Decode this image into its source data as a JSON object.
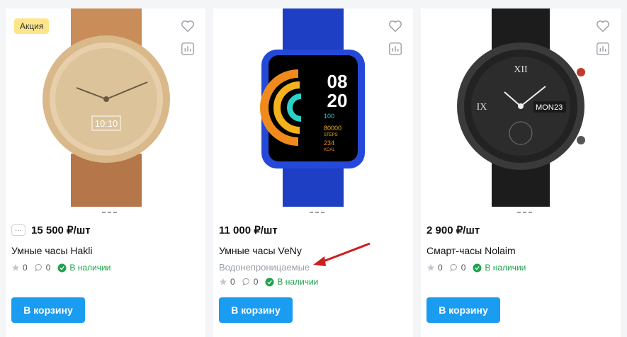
{
  "products": [
    {
      "badge": "Акция",
      "price": "15 500 ₽/шт",
      "title": "Умные часы Hakli",
      "feature": "",
      "rating": "0",
      "reviews": "0",
      "stock": "В наличии",
      "button": "В корзину",
      "more": "···"
    },
    {
      "badge": "",
      "price": "11 000 ₽/шт",
      "title": "Умные часы VeNy",
      "feature": "Водонепроницаемые",
      "rating": "0",
      "reviews": "0",
      "stock": "В наличии",
      "button": "В корзину",
      "watch_face": {
        "hours": "08",
        "minutes": "20",
        "steps_value": "80000",
        "steps_label": "STEPS",
        "kcal_value": "234",
        "kcal_label": "KCAL",
        "percent": "100"
      }
    },
    {
      "badge": "",
      "price": "2 900 ₽/шт",
      "title": "Смарт-часы Nolaim",
      "feature": "",
      "rating": "0",
      "reviews": "0",
      "stock": "В наличии",
      "button": "В корзину",
      "watch_face": {
        "day": "MON",
        "date": "23"
      }
    }
  ],
  "colors": {
    "accent": "#1a9cf0",
    "stock": "#1fa24a",
    "badge": "#ffe58a",
    "annotation_arrow": "#cc1f1f"
  },
  "icons": {
    "favorite": "heart-icon",
    "compare": "bar-chart-icon",
    "rating": "star-icon",
    "reviews": "comment-icon",
    "stock": "check-circle-icon"
  }
}
